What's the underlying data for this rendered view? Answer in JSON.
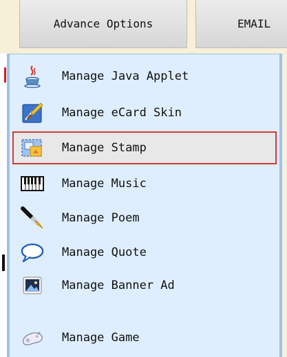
{
  "tabs": {
    "advance": "Advance Options",
    "email": "EMAIL"
  },
  "menu": {
    "items": [
      {
        "label": "Manage Java Applet",
        "icon": "java-icon"
      },
      {
        "label": "Manage eCard Skin",
        "icon": "paint-brush-icon"
      },
      {
        "label": "Manage Stamp",
        "icon": "stamp-icon",
        "selected": true
      },
      {
        "label": "Manage Music",
        "icon": "piano-keyboard-icon"
      },
      {
        "label": "Manage Poem",
        "icon": "fountain-pen-icon"
      },
      {
        "label": "Manage Quote",
        "icon": "speech-bubble-icon"
      },
      {
        "label": "Manage Banner Ad",
        "icon": "picture-icon"
      },
      {
        "label": "Manage Game",
        "icon": "gamepad-icon"
      }
    ]
  },
  "colors": {
    "menu_background": "#dfeefe",
    "menu_border": "#9cc2ea",
    "selected_border": "#d23a3a",
    "selected_background": "#e8e8e8"
  }
}
